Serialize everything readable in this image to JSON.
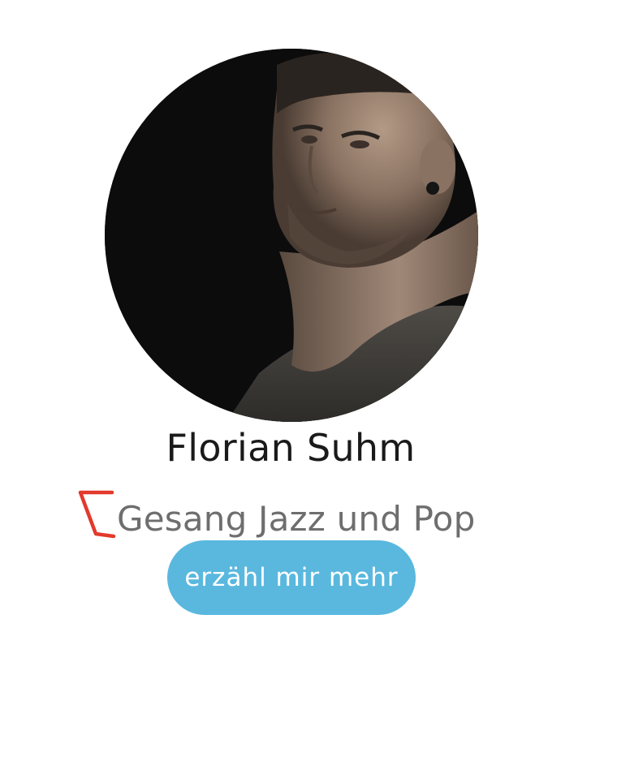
{
  "profile": {
    "name": "Florian Suhm",
    "subtitle": "Gesang Jazz und Pop",
    "cta_label": "erzähl mir mehr",
    "photo_icon": "portrait-photo"
  },
  "colors": {
    "accent": "#e2392b",
    "button": "#5ab8de",
    "name_text": "#1a1a1a",
    "subtitle_text": "#6e6e6e"
  }
}
